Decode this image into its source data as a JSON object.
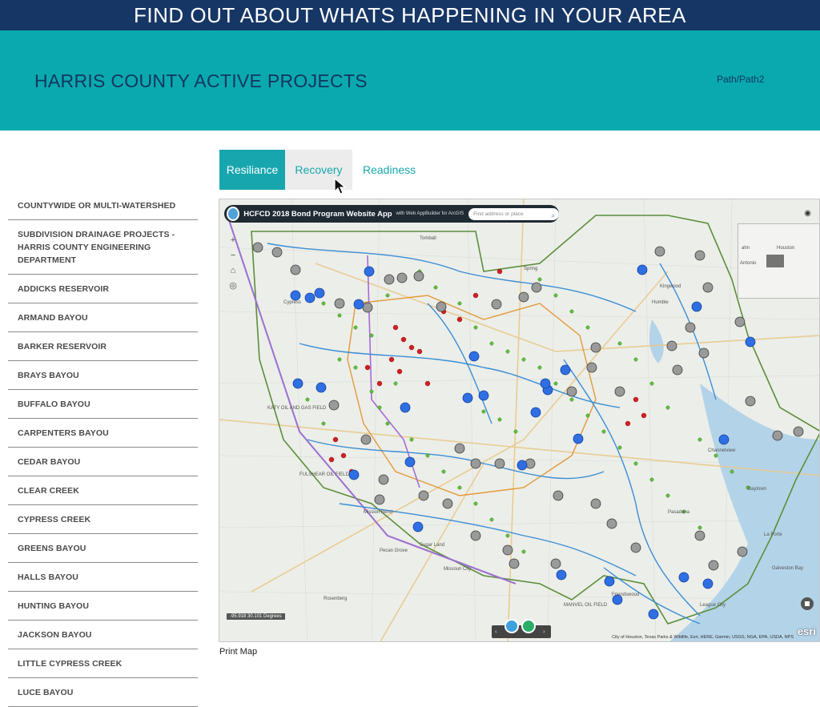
{
  "banner": {
    "text": "FIND OUT ABOUT WHATS HAPPENING IN YOUR AREA"
  },
  "hero": {
    "title": "HARRIS COUNTY ACTIVE PROJECTS",
    "breadcrumb": "Path/Path2"
  },
  "tabs": [
    {
      "label": "Resiliance",
      "state": "active"
    },
    {
      "label": "Recovery",
      "state": "hover"
    },
    {
      "label": "Readiness",
      "state": "normal"
    }
  ],
  "watersheds": [
    "COUNTYWIDE OR MULTI-WATERSHED",
    "SUBDIVISION DRAINAGE PROJECTS - HARRIS COUNTY ENGINEERING DEPARTMENT",
    "ADDICKS RESERVOIR",
    "ARMAND BAYOU",
    "BARKER RESERVOIR",
    "BRAYS BAYOU",
    "BUFFALO BAYOU",
    "CARPENTERS BAYOU",
    "CEDAR BAYOU",
    "CLEAR CREEK",
    "CYPRESS CREEK",
    "GREENS BAYOU",
    "HALLS BAYOU",
    "HUNTING BAYOU",
    "JACKSON BAYOU",
    "LITTLE CYPRESS CREEK",
    "LUCE BAYOU"
  ],
  "map": {
    "app_title": "HCFCD 2018 Bond Program Website App",
    "app_subtitle": "with Web AppBuilder for ArcGIS",
    "search_placeholder": "Find address or place",
    "zoom_in": "+",
    "zoom_out": "−",
    "home": "⌂",
    "locate": "◎",
    "coords": "-95.918 30.101 Degrees",
    "attribution": "City of Houston, Texas Parks & Wildlife, Esri, HERE, Garmin, USGS, NGA, EPA, USDA, NPS",
    "esri_logo": "esri",
    "overview_labels": [
      "Houston",
      "Antonio",
      "ahn"
    ],
    "place_labels": [
      "KATY OIL AND GAS FIELD",
      "FULSHEAR OIL FIELD",
      "Mission Bend",
      "Sugar Land",
      "Missouri City",
      "Pecan Grove",
      "Rosenberg",
      "Friendswood",
      "League City",
      "Pasadena",
      "Baytown",
      "Humble",
      "Spring",
      "Kingwood",
      "Tomball",
      "Cypress",
      "MANVEL OIL FIELD",
      "Galveston Bay",
      "Channelview",
      "La Porte"
    ],
    "colors": {
      "county_boundary": "#5a8f3a",
      "bayou": "#3b8ed6",
      "red_point": "#d11f1f",
      "green_point": "#5cc135",
      "blue_point": "#2f6fe3",
      "gray_point": "#9a9a9a"
    }
  },
  "footer": {
    "print_label": "Print Map"
  }
}
